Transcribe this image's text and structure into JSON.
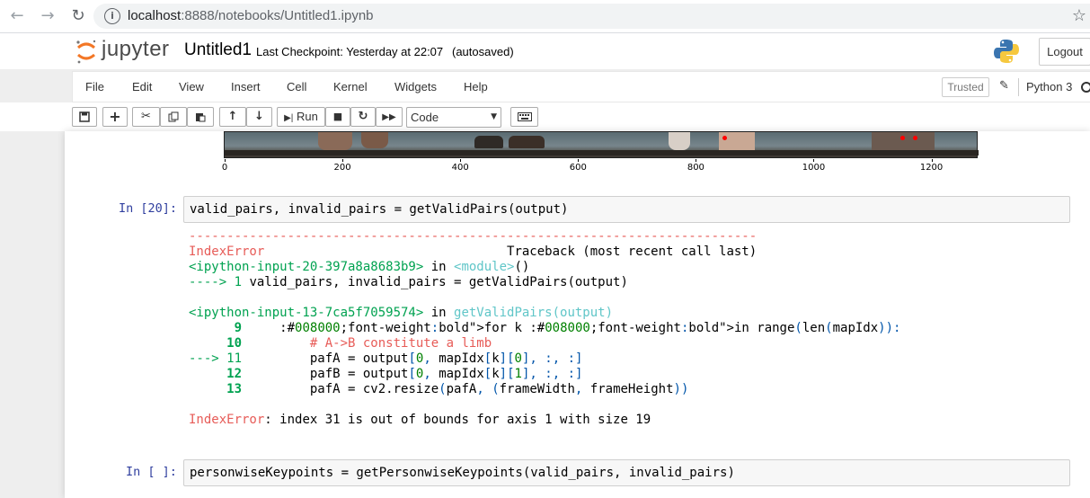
{
  "browser": {
    "url_host": "localhost",
    "url_path": ":8888/notebooks/Untitled1.ipynb",
    "info_icon": "info-icon",
    "star_icon": "star-icon"
  },
  "header": {
    "logo_text": "jupyter",
    "notebook_name": "Untitled1",
    "checkpoint": "Last Checkpoint: Yesterday at 22:07",
    "autosave": "(autosaved)",
    "logout_label": "Logout"
  },
  "menubar": {
    "items": [
      "File",
      "Edit",
      "View",
      "Insert",
      "Cell",
      "Kernel",
      "Widgets",
      "Help"
    ],
    "trusted_label": "Trusted",
    "kernel_name": "Python 3"
  },
  "toolbar": {
    "run_label": "Run",
    "cell_type": "Code",
    "buttons": [
      "save-icon",
      "plus-icon",
      "cut-icon",
      "copy-icon",
      "paste-icon",
      "arrow-up-icon",
      "arrow-down-icon",
      "run-icon",
      "stop-icon",
      "restart-icon",
      "fast-forward-icon",
      "keyboard-icon"
    ]
  },
  "figure": {
    "x_ticks": [
      "0",
      "200",
      "400",
      "600",
      "800",
      "1000",
      "1200"
    ]
  },
  "cells": [
    {
      "prompt": "In [20]:",
      "code": "valid_pairs, invalid_pairs = getValidPairs(output)"
    },
    {
      "prompt": "In [ ]:",
      "code": "personwiseKeypoints = getPersonwiseKeypoints(valid_pairs, invalid_pairs)"
    }
  ],
  "traceback": {
    "dashes": "---------------------------------------------------------------------------",
    "error_name": "IndexError",
    "traceback_label": "Traceback (most recent call last)",
    "input20": "<ipython-input-20-397a8a8683b9>",
    "in_word": " in ",
    "module": "<module>",
    "module_paren": "()",
    "arrow1": "----> 1 ",
    "line1": "valid_pairs, invalid_pairs = getValidPairs(output)",
    "input13": "<ipython-input-13-7ca5f7059574>",
    "func": "getValidPairs(output)",
    "l9_no": "      9 ",
    "l9": "    for k in range(len(mapIdx)):",
    "l10_no": "     10 ",
    "l10": "        # A->B constitute a limb",
    "l11_no": "---> 11 ",
    "l11": "        pafA = output[0, mapIdx[k][0], :, :]",
    "l12_no": "     12 ",
    "l12": "        pafB = output[0, mapIdx[k][1], :, :]",
    "l13_no": "     13 ",
    "l13": "        pafA = cv2.resize(pafA, (frameWidth, frameHeight))",
    "final_error": "IndexError",
    "final_msg": ": index 31 is out of bounds for axis 1 with size 19"
  }
}
